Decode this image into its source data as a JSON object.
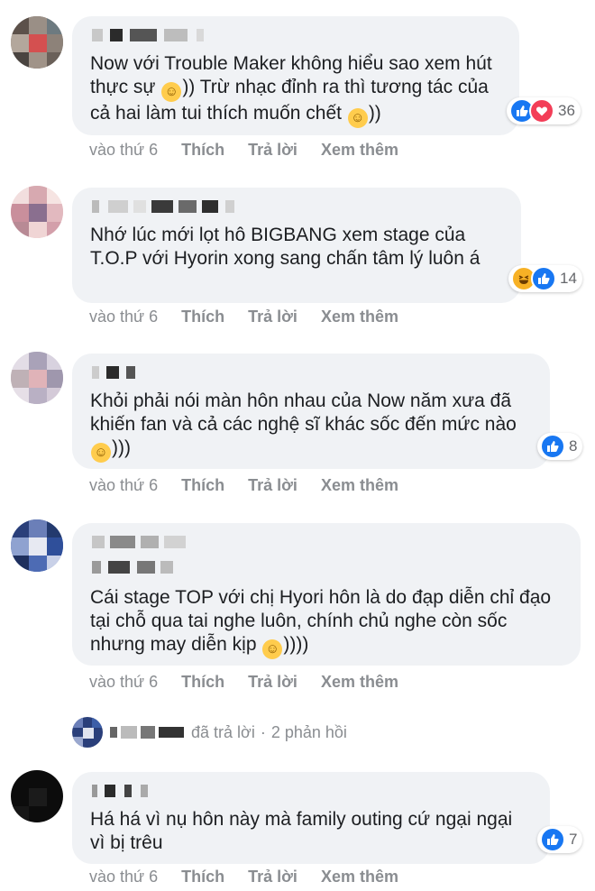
{
  "comments": [
    {
      "text_parts": [
        "Now với Trouble Maker không hiểu sao xem hút thực sự ",
        ")) Trừ nhạc đỉnh ra thì tương tác của cả hai làm tui thích muốn chết ",
        "))"
      ],
      "reactions": [
        "like-icon",
        "love-icon"
      ],
      "reaction_count": "36",
      "time": "vào thứ 6",
      "like_label": "Thích",
      "reply_label": "Trả lời",
      "more_label": "Xem thêm"
    },
    {
      "text_parts": [
        "Nhớ lúc mới lọt hô BIGBANG xem stage của T.O.P với Hyorin xong sang chấn tâm lý luôn á"
      ],
      "reactions": [
        "haha-icon",
        "like-icon"
      ],
      "reaction_count": "14",
      "time": "vào thứ 6",
      "like_label": "Thích",
      "reply_label": "Trả lời",
      "more_label": "Xem thêm"
    },
    {
      "text_parts": [
        "Khỏi phải nói màn hôn nhau của Now năm xưa đã khiến fan và cả các nghệ sĩ khác sốc đến mức nào ",
        ")))"
      ],
      "reactions": [
        "like-icon"
      ],
      "reaction_count": "8",
      "time": "vào thứ 6",
      "like_label": "Thích",
      "reply_label": "Trả lời",
      "more_label": "Xem thêm"
    },
    {
      "text_parts": [
        "Cái stage TOP với chị Hyori hôn là do đạp diễn chỉ đạo tại chỗ qua tai nghe luôn, chính chủ nghe còn sốc nhưng may diễn kịp ",
        "))))"
      ],
      "reactions": [],
      "reaction_count": "",
      "time": "vào thứ 6",
      "like_label": "Thích",
      "reply_label": "Trả lời",
      "more_label": "Xem thêm"
    },
    {
      "text_parts": [
        "Há há vì nụ hôn này mà family outing cứ ngại ngại vì bị trêu"
      ],
      "reactions": [
        "like-icon"
      ],
      "reaction_count": "7",
      "time": "vào thứ 6",
      "like_label": "Thích",
      "reply_label": "Trả lời",
      "more_label": "Xem thêm"
    }
  ],
  "replies_summary": {
    "replied_label": "đã trả lời",
    "separator": "·",
    "count_label": "2 phản hồi"
  },
  "colors": {
    "bubble": "#f0f2f5",
    "meta_text": "#8a8d91",
    "like_blue": "#1877f2",
    "love_red": "#f33e58",
    "haha_yellow": "#f7b125"
  }
}
